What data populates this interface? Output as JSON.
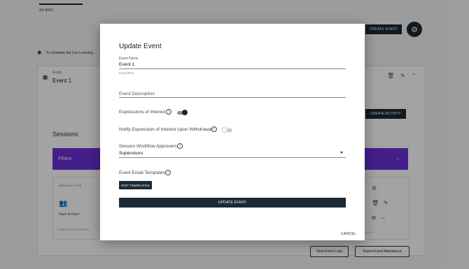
{
  "background": {
    "code": "AR-8090",
    "create_event_label": "CREATE EVENT",
    "settings_icon": "gear-icon",
    "info_text": "To complete the Live Learning ...",
    "event_label": "Event",
    "event_name": "Event 1",
    "create_activity_label": "CREATE ACTIVITY",
    "sessions_heading": "Sessions",
    "filters_label": "Filters",
    "session_type_header": "SESSION TYPE",
    "session_type_value": "Face to Face",
    "load_more": "Load more Sessions",
    "pager_text": "1-1 of 1",
    "view_event_logs": "View Event Logs",
    "export_event_attendance": "Export Event Attendance",
    "accent_color": "#6b2fd6"
  },
  "dialog": {
    "title": "Update Event",
    "event_name_label": "Event Name",
    "event_name_value": "Event 1",
    "required_text": "REQUIRED",
    "event_description_placeholder": "Event Description",
    "expressions_of_interest_label": "Expressions of Interest",
    "expressions_of_interest_on": true,
    "notify_withdrawal_label": "Notify Expression of Interest Upon Withdrawal",
    "notify_withdrawal_on": false,
    "approvers_label": "Session Workflow Approvers",
    "approvers_value": "Supervisors",
    "email_templates_label": "Event Email Templates",
    "edit_templates_label": "EDIT TEMPLATES",
    "update_event_label": "UPDATE EVENT",
    "cancel_label": "CANCEL",
    "primary_color": "#1c2a33"
  }
}
